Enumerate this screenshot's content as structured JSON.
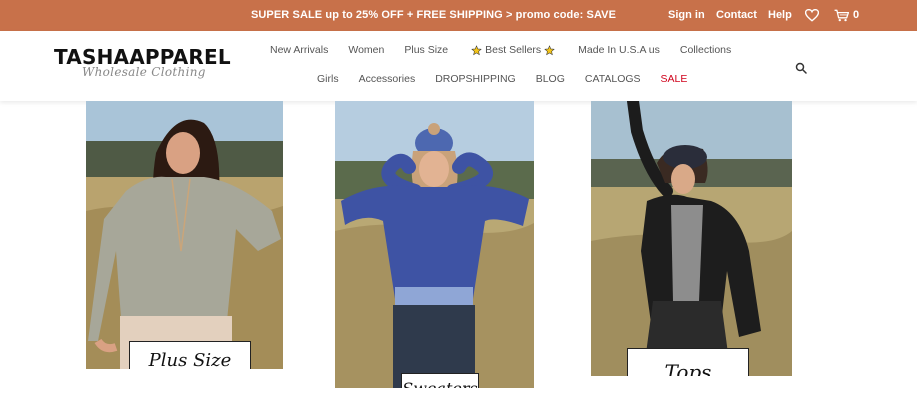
{
  "promo": {
    "text": "SUPER SALE up to 25% OFF + FREE SHIPPING > promo code: SAVE",
    "signin": "Sign in",
    "contact": "Contact",
    "help": "Help",
    "cart_count": "0"
  },
  "header": {
    "logo": "TASHAAPPAREL",
    "tagline": "Wholesale Clothing"
  },
  "nav": {
    "row1": [
      "New Arrivals",
      "Women",
      "Plus Size",
      "Best Sellers",
      "Made In U.S.A us",
      "Collections"
    ],
    "row2": [
      "Girls",
      "Accessories",
      "DROPSHIPPING",
      "BLOG",
      "CATALOGS",
      "SALE"
    ]
  },
  "categories": [
    {
      "label": "Plus Size"
    },
    {
      "label": "Sweaters"
    },
    {
      "label": "Tops"
    }
  ],
  "colors": {
    "promo_bg": "#c8714a",
    "sale": "#d0021b"
  }
}
